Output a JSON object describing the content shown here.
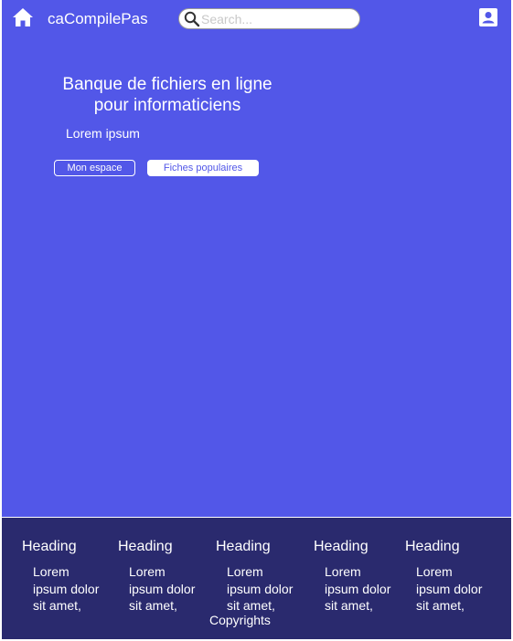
{
  "header": {
    "brand": "caCompilePas",
    "search_placeholder": "Search...",
    "icons": {
      "home": "home-icon",
      "search": "search-icon",
      "account": "account-icon"
    }
  },
  "hero": {
    "title": "Banque de fichiers en ligne pour informaticiens",
    "subtitle": "Lorem ipsum",
    "buttons": {
      "primary_label": "Mon espace",
      "secondary_label": "Fiches populaires"
    }
  },
  "footer": {
    "columns": [
      {
        "heading": "Heading",
        "text": "Lorem ipsum dolor sit amet,"
      },
      {
        "heading": "Heading",
        "text": "Lorem ipsum dolor sit amet,"
      },
      {
        "heading": "Heading",
        "text": "Lorem ipsum dolor sit amet,"
      },
      {
        "heading": "Heading",
        "text": "Lorem ipsum dolor sit amet,"
      },
      {
        "heading": "Heading",
        "text": "Lorem ipsum dolor sit amet,"
      }
    ],
    "copyright": "Copyrights"
  },
  "colors": {
    "main_background": "#5257e8",
    "footer_background": "#2a2a6e",
    "text_light": "#ffffff"
  }
}
